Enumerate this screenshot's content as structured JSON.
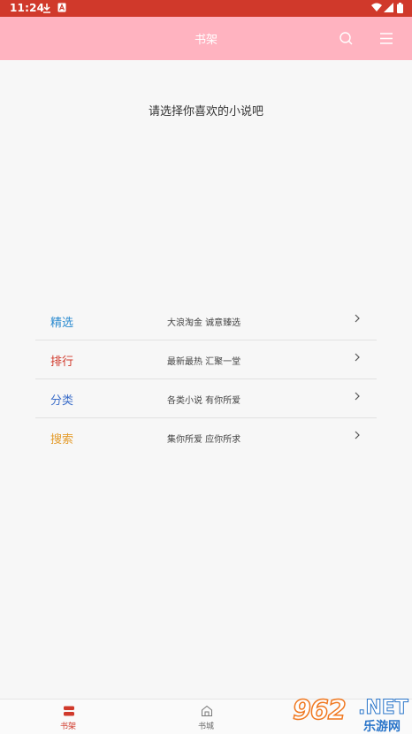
{
  "status_bar": {
    "time": "11:24"
  },
  "header": {
    "title": "书架"
  },
  "prompt": "请选择你喜欢的小说吧",
  "options": [
    {
      "title": "精选",
      "description": "大浪淘金 诚意臻选",
      "color": "#2b8bd0"
    },
    {
      "title": "排行",
      "description": "最新最热 汇聚一堂",
      "color": "#d0392b"
    },
    {
      "title": "分类",
      "description": "各类小说 有你所爱",
      "color": "#3c6ec9"
    },
    {
      "title": "搜索",
      "description": "集你所爱 应你所求",
      "color": "#e49c2c"
    }
  ],
  "bottom_nav": [
    {
      "label": "书架",
      "icon": "bookshelf-icon",
      "active": true
    },
    {
      "label": "书城",
      "icon": "bookstore-icon",
      "active": false
    }
  ],
  "watermark": {
    "logo": "962",
    "net": ".NET",
    "sub": "乐游网"
  },
  "colors": {
    "status_bar": "#d0392b",
    "header": "#ffb3c0",
    "active_tab": "#d0392b"
  }
}
